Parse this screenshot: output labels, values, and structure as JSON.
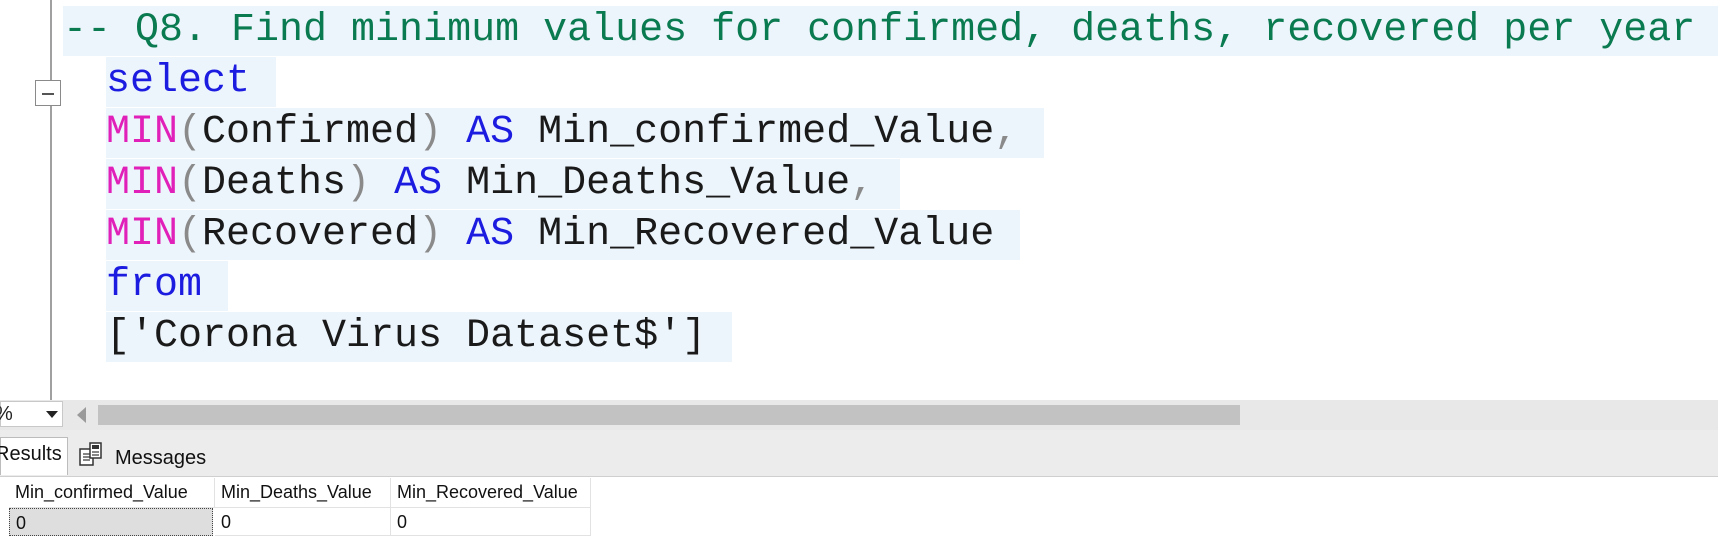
{
  "editor": {
    "comment_line": "-- Q8. Find minimum values for confirmed, deaths, recovered per year",
    "lines": {
      "select_kw": "select",
      "min1_fn": "MIN",
      "min1_open": "(",
      "min1_arg": "Confirmed",
      "min1_close": ")",
      "min1_as": "AS",
      "min1_alias": "Min_confirmed_Value",
      "min1_comma": ",",
      "min2_fn": "MIN",
      "min2_open": "(",
      "min2_arg": "Deaths",
      "min2_close": ")",
      "min2_as": "AS",
      "min2_alias": "Min_Deaths_Value",
      "min2_comma": ",",
      "min3_fn": "MIN",
      "min3_open": "(",
      "min3_arg": "Recovered",
      "min3_close": ")",
      "min3_as": "AS",
      "min3_alias": "Min_Recovered_Value",
      "from_kw": "from",
      "table_name": "['Corona Virus Dataset$']"
    }
  },
  "toolbar": {
    "zoom_value": "%"
  },
  "tabs": {
    "results_label": "Results",
    "messages_label": "Messages"
  },
  "results": {
    "columns": [
      "Min_confirmed_Value",
      "Min_Deaths_Value",
      "Min_Recovered_Value"
    ],
    "rows": [
      [
        "0",
        "0",
        "0"
      ]
    ]
  },
  "colors": {
    "comment": "#0a7a50",
    "keyword": "#1c1ce0",
    "function": "#e020b8",
    "line_highlight": "#edf5fc"
  }
}
